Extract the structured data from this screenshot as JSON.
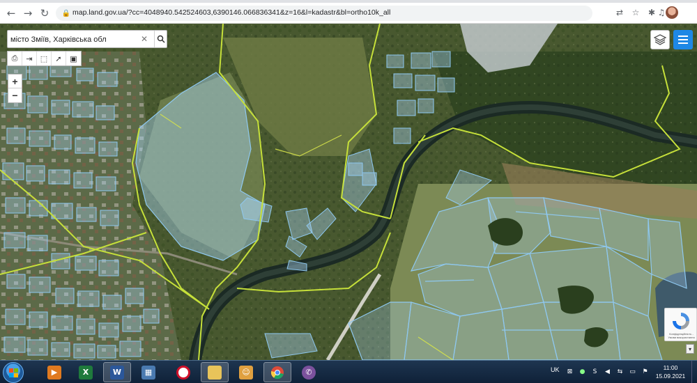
{
  "browser": {
    "url": "map.land.gov.ua/?cc=4048940.542524603,6390146.066836341&z=16&l=kadastr&bl=ortho10k_all",
    "icons": {
      "back": "arrow-left-icon",
      "forward": "arrow-right-icon",
      "reload": "reload-icon",
      "lock": "lock-icon",
      "translate": "translate-icon",
      "star": "star-icon",
      "extensions": "puzzle-icon",
      "media": "music-icon"
    }
  },
  "map": {
    "search": {
      "value": "місто Зміїв, Харківська обл",
      "clear_glyph": "✕",
      "go_glyph": "🔍"
    },
    "zoom": {
      "in": "+",
      "out": "−"
    },
    "tools": [
      "print-icon",
      "measure-icon",
      "select-area-icon",
      "pointer-icon",
      "info-icon"
    ],
    "recaptcha_label": "Конфіденційність - Умови використання",
    "colors": {
      "boundary": "#c6e03a",
      "parcel_stroke": "#8ec8f0",
      "parcel_fill": "#a9d4f5",
      "accent": "#1e88e5"
    }
  },
  "taskbar": {
    "apps": [
      {
        "name": "media-player",
        "glyph": "▶",
        "color": "#e07a1f"
      },
      {
        "name": "excel",
        "glyph": "X",
        "color": "#1f7a3c"
      },
      {
        "name": "word",
        "glyph": "W",
        "color": "#2b579a"
      },
      {
        "name": "contacts",
        "glyph": "▦",
        "color": "#4a7ab0"
      },
      {
        "name": "opera",
        "glyph": "O",
        "color": "#d0102a"
      },
      {
        "name": "explorer",
        "glyph": "▬",
        "color": "#e8c45a"
      },
      {
        "name": "users",
        "glyph": "☺",
        "color": "#e0a040"
      },
      {
        "name": "chrome",
        "glyph": "◉",
        "color": "#dd4b39"
      },
      {
        "name": "viber",
        "glyph": "✆",
        "color": "#7b519d"
      }
    ],
    "language": "UK",
    "time": "11:00",
    "date": "15.09.2021"
  }
}
